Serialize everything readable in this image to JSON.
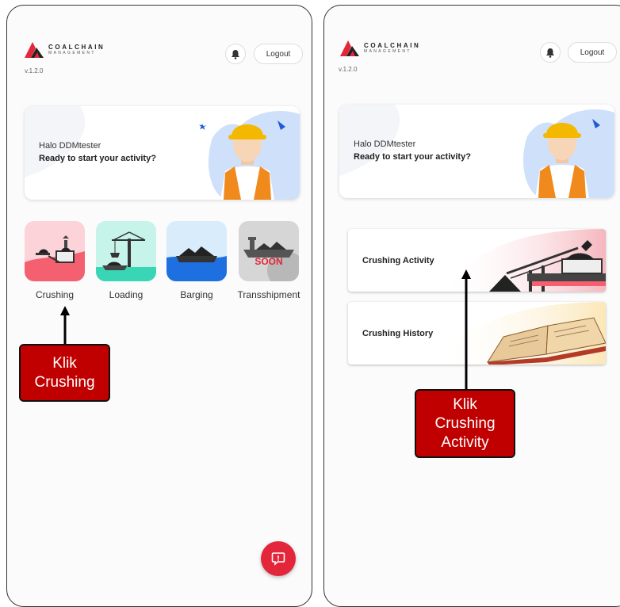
{
  "left_screen": {
    "logo": {
      "name": "COALCHAIN",
      "sub": "MANAGEMENT"
    },
    "version": "v.1.2.0",
    "header": {
      "bell_icon": "bell-icon",
      "logout_label": "Logout"
    },
    "greeting": {
      "hello": "Halo DDMtester",
      "question": "Ready to start your activity?"
    },
    "menu": [
      {
        "label": "Crushing",
        "icon": "crushing-icon"
      },
      {
        "label": "Loading",
        "icon": "loading-crane-icon"
      },
      {
        "label": "Barging",
        "icon": "barge-icon"
      },
      {
        "label": "Transshipment",
        "icon": "ship-icon",
        "badge": "SOON"
      }
    ],
    "callout": {
      "line1": "Klik",
      "line2": "Crushing"
    },
    "fab_icon": "feedback-icon"
  },
  "right_screen": {
    "logo": {
      "name": "COALCHAIN",
      "sub": "MANAGEMENT"
    },
    "version": "v.1.2.0",
    "header": {
      "bell_icon": "bell-icon",
      "logout_label": "Logout"
    },
    "greeting": {
      "hello": "Halo DDMtester",
      "question": "Ready to start your activity?"
    },
    "options": [
      {
        "label": "Crushing Activity",
        "icon": "crusher-conveyor-icon"
      },
      {
        "label": "Crushing History",
        "icon": "open-book-icon"
      }
    ],
    "callout": {
      "line1": "Klik",
      "line2": "Crushing",
      "line3": "Activity"
    }
  },
  "colors": {
    "brand_red": "#e3263a",
    "callout_red": "#c00000",
    "crushing_tile": "#fbd3d8",
    "loading_tile": "#c6f4ea",
    "barging_tile": "#d9ecfb",
    "transshipment_tile": "#d6d6d6"
  }
}
